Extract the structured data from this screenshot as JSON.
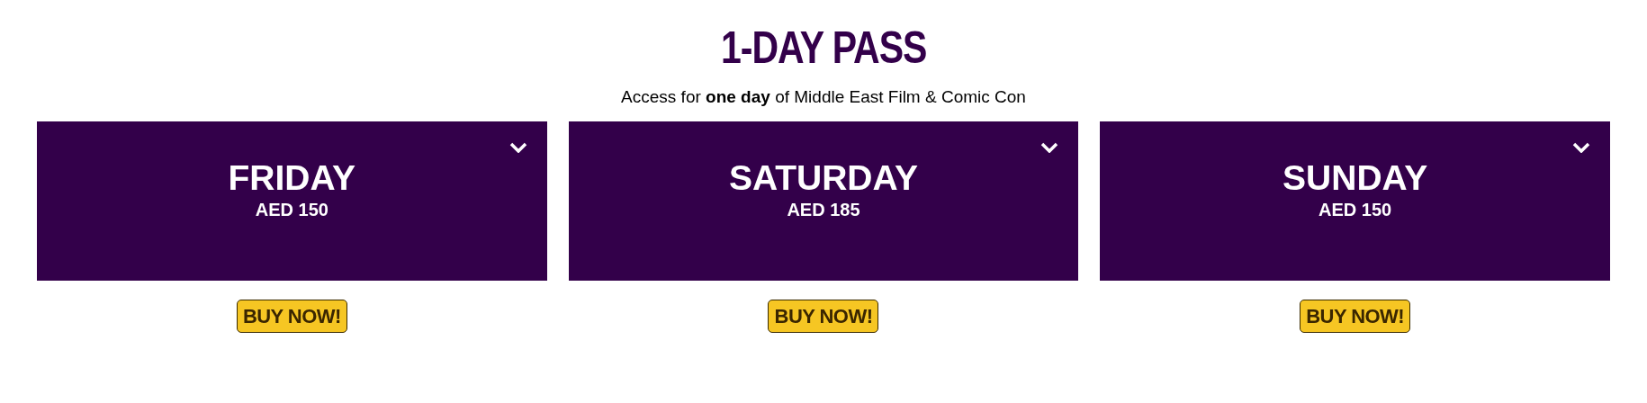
{
  "heading": {
    "title": "1-DAY PASS",
    "subtitle": "Access for **one day** of Middle East Film & Comic Con"
  },
  "passes": [
    {
      "day": "FRIDAY",
      "price": "AED 150",
      "expanded": false,
      "button": "BUY NOW!"
    },
    {
      "day": "SATURDAY",
      "price": "AED 185",
      "expanded": false,
      "button": "BUY NOW!"
    },
    {
      "day": "SUNDAY",
      "price": "AED 150",
      "expanded": false,
      "button": "BUY NOW!"
    }
  ]
}
